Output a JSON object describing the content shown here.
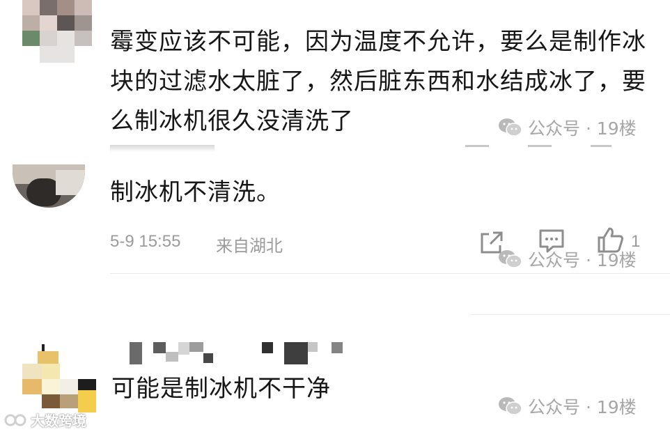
{
  "comment1": {
    "text": "霉变应该不可能，因为温度不允许，要么是制作冰块的过滤水太脏了，然后脏东西和水结成冰了，要么制冰机很久没清洗了",
    "watermark_text": "公众号 · 19楼"
  },
  "comment2": {
    "text": "制冰机不清洗。",
    "time": "5-9 15:55",
    "location": "来自湖北",
    "like_count": "1",
    "watermark_text": "公众号 · 19楼"
  },
  "comment3": {
    "text": "可能是制冰机不干净",
    "watermark_text": "公众号 · 19楼"
  },
  "watermark_bottom_left": "大数跨境",
  "colors": {
    "text": "#161616",
    "meta": "#9b9b9b",
    "divider": "#e9e9e9",
    "watermark": "#a6a6a6"
  },
  "icons": [
    "share-icon",
    "comment-icon",
    "like-icon",
    "wechat-icon"
  ]
}
